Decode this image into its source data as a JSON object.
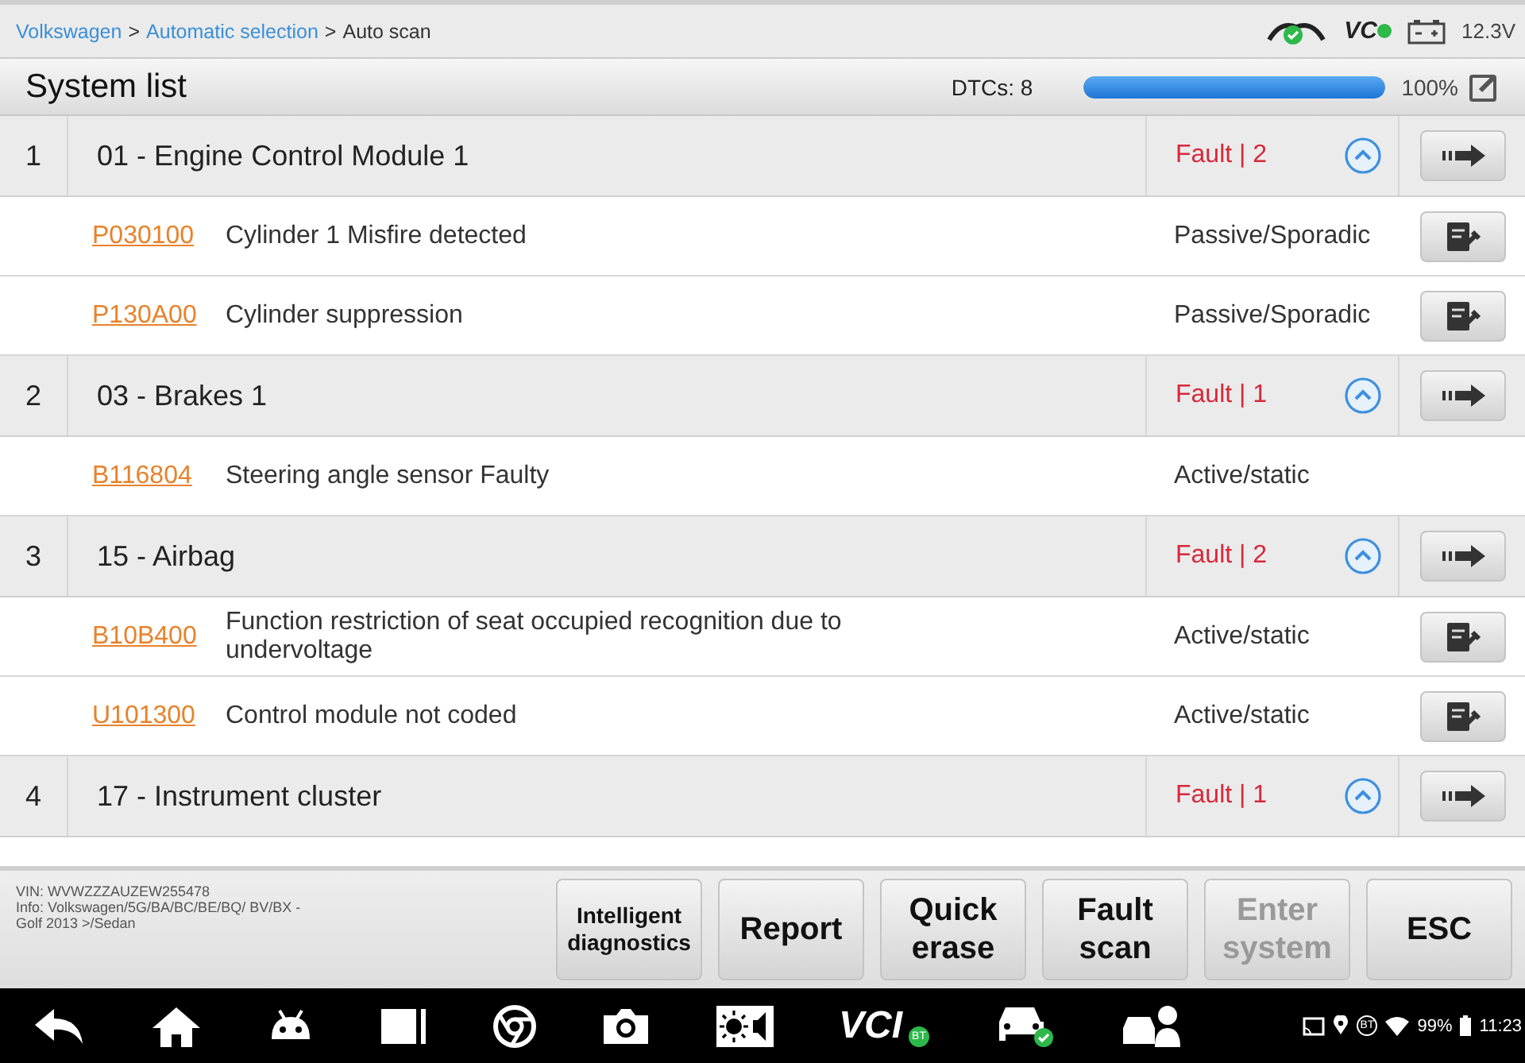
{
  "breadcrumb": [
    {
      "label": "Volkswagen",
      "link": true
    },
    {
      "label": "Automatic selection",
      "link": true
    },
    {
      "label": "Auto scan",
      "link": false
    }
  ],
  "breadcrumb_separator": ">",
  "top_status": {
    "vci_label": "VC",
    "voltage": "12.3V"
  },
  "header": {
    "title": "System list",
    "dtc_count": "DTCs: 8",
    "level": 1.0,
    "percent": "100%"
  },
  "systems": [
    {
      "index": "1",
      "name": "01 - Engine Control Module 1",
      "status": "Fault | 2",
      "expanded": true,
      "dtcs": [
        {
          "code": "P030100",
          "description": "Cylinder 1  Misfire detected",
          "status": "Passive/Sporadic",
          "help_button": true
        },
        {
          "code": "P130A00",
          "description": "Cylinder suppression",
          "status": "Passive/Sporadic",
          "help_button": true
        }
      ]
    },
    {
      "index": "2",
      "name": "03 - Brakes 1",
      "status": "Fault | 1",
      "expanded": true,
      "dtcs": [
        {
          "code": "B116804",
          "description": "Steering angle sensor  Faulty",
          "status": "Active/static",
          "help_button": false
        }
      ]
    },
    {
      "index": "3",
      "name": "15 - Airbag",
      "status": "Fault | 2",
      "expanded": true,
      "dtcs": [
        {
          "code": "B10B400",
          "description": "Function restriction of seat occupied recognition  due to undervoltage",
          "status": "Active/static",
          "help_button": true
        },
        {
          "code": "U101300",
          "description": "Control module not coded",
          "status": "Active/static",
          "help_button": true
        }
      ]
    },
    {
      "index": "4",
      "name": "17 - Instrument cluster",
      "status": "Fault | 1",
      "expanded": true
    }
  ],
  "vehicle_info": {
    "vin": "VIN: WVWZZZAUZEW255478",
    "info": "Info: Volkswagen/5G/BA/BC/BE/BQ/ BV/BX - Golf 2013 >/Sedan"
  },
  "buttons": [
    {
      "label": "Intelligent diagnostics",
      "disabled": false,
      "kind": "small"
    },
    {
      "label": "Report",
      "disabled": false,
      "kind": "large"
    },
    {
      "label": "Quick erase",
      "disabled": false,
      "kind": "large"
    },
    {
      "label": "Fault scan",
      "disabled": false,
      "kind": "large"
    },
    {
      "label": "Enter system",
      "disabled": true,
      "kind": "large"
    },
    {
      "label": "ESC",
      "disabled": false,
      "kind": "large"
    }
  ],
  "nav_bar": {
    "vci_label": "VCI",
    "vci_badge": "BT",
    "bt_label": "BT",
    "battery": "99%",
    "time": "11:23"
  }
}
